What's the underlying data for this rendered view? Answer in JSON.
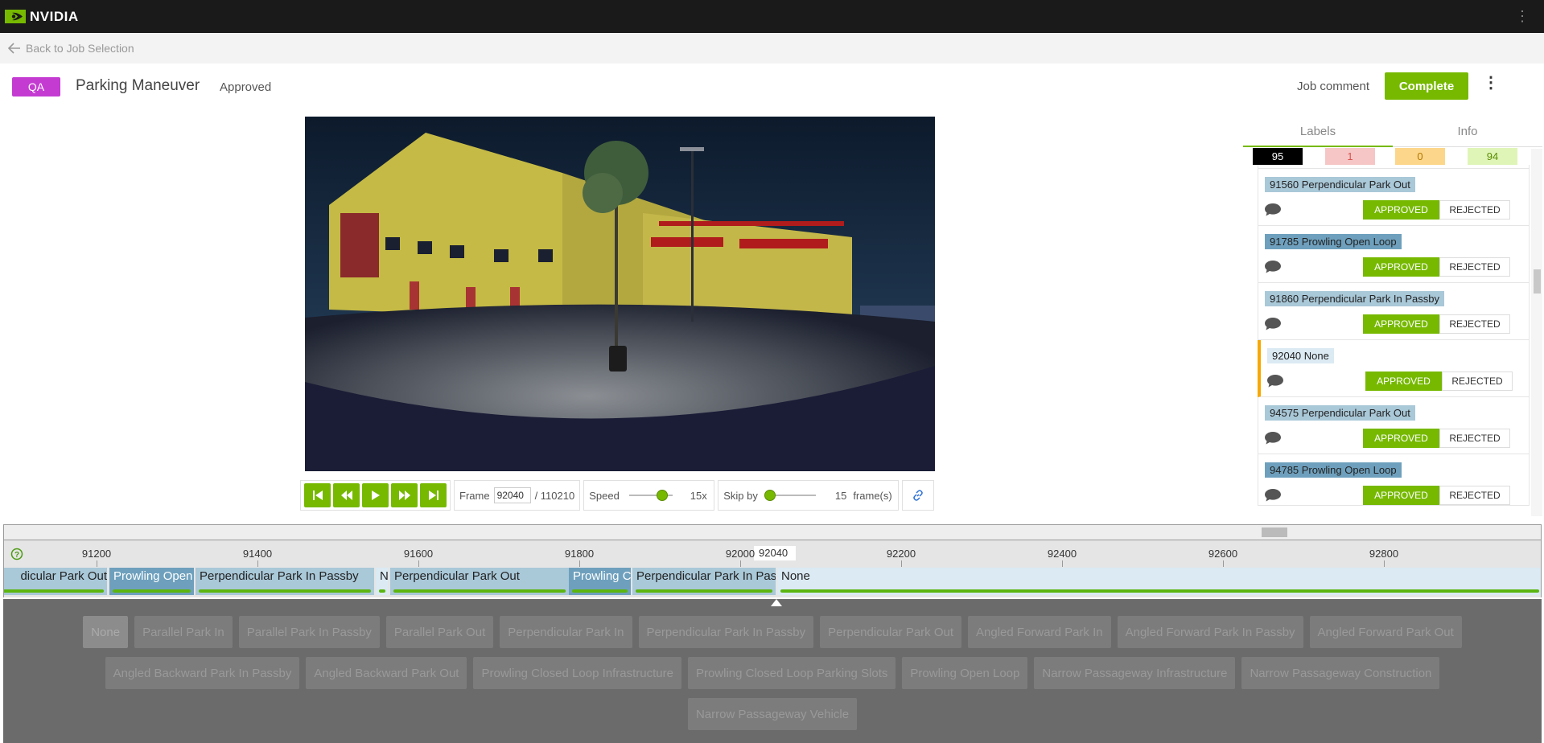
{
  "topbar": {
    "brand": "NVIDIA",
    "menu_icon": "vertical-dots"
  },
  "back_link": "Back to Job Selection",
  "header": {
    "badge": "QA",
    "title": "Parking Maneuver",
    "status": "Approved",
    "job_comment": "Job comment",
    "complete_label": "Complete"
  },
  "player": {
    "frame_label": "Frame",
    "frame_value": "92040",
    "frame_total": "/ 110210",
    "speed_label": "Speed",
    "speed_value": "15x",
    "speed_level": 0.85,
    "skip_label": "Skip by",
    "skip_value": "15",
    "skip_unit": "frame(s)",
    "skip_level": 0.0
  },
  "panel": {
    "tabs": [
      "Labels",
      "Info"
    ],
    "counts": [
      {
        "value": "95",
        "bg": "#000000",
        "fg": "#ffffff"
      },
      {
        "value": "1",
        "bg": "#f6c6c6",
        "fg": "#d9534f"
      },
      {
        "value": "0",
        "bg": "#fcd68a",
        "fg": "#b07800"
      },
      {
        "value": "94",
        "bg": "#dff5b8",
        "fg": "#5a8c00"
      }
    ],
    "approved_label": "APPROVED",
    "rejected_label": "REJECTED",
    "items": [
      {
        "label": "",
        "color": "#ffffff",
        "selected": false,
        "partial": true
      },
      {
        "label": "91560 Perpendicular Park Out",
        "color": "#a9c8d8",
        "selected": false
      },
      {
        "label": "91785 Prowling Open Loop",
        "color": "#6ea0bd",
        "selected": false
      },
      {
        "label": "91860 Perpendicular Park In Passby",
        "color": "#a9c8d8",
        "selected": false
      },
      {
        "label": "92040 None",
        "color": "#dbeaf3",
        "selected": true
      },
      {
        "label": "94575 Perpendicular Park Out",
        "color": "#a9c8d8",
        "selected": false
      },
      {
        "label": "94785 Prowling Open Loop",
        "color": "#6ea0bd",
        "selected": false
      }
    ]
  },
  "timeline": {
    "ticks": [
      "91200",
      "91400",
      "91600",
      "91800",
      "92000",
      "92200",
      "92400",
      "92600",
      "92800"
    ],
    "current_frame": "92040",
    "segments": [
      {
        "label": "dicular Park Out",
        "color": "#a9c8d8",
        "text_color": "#222"
      },
      {
        "label": "Prowling Open",
        "color": "#6ea0bd",
        "text_color": "#ffffff"
      },
      {
        "label": "Perpendicular Park In Passby",
        "color": "#a9c8d8",
        "text_color": "#222"
      },
      {
        "label": "N",
        "color": "#dbeaf3",
        "text_color": "#222"
      },
      {
        "label": "Perpendicular Park Out",
        "color": "#a9c8d8",
        "text_color": "#222"
      },
      {
        "label": "Prowling C",
        "color": "#6ea0bd",
        "text_color": "#ffffff"
      },
      {
        "label": "Perpendicular Park In Pass",
        "color": "#a9c8d8",
        "text_color": "#222"
      },
      {
        "label": "None",
        "color": "#dbeaf3",
        "text_color": "#222"
      }
    ]
  },
  "categories": [
    [
      "None",
      "Parallel Park In",
      "Parallel Park In Passby",
      "Parallel Park Out",
      "Perpendicular Park In",
      "Perpendicular Park In Passby",
      "Perpendicular Park Out",
      "Angled Forward Park In",
      "Angled Forward Park In Passby",
      "Angled Forward Park Out"
    ],
    [
      "Angled Backward Park In Passby",
      "Angled Backward Park Out",
      "Prowling Closed Loop Infrastructure",
      "Prowling Closed Loop Parking Slots",
      "Prowling Open Loop",
      "Narrow Passageway Infrastructure",
      "Narrow Passageway Construction"
    ],
    [
      "Narrow Passageway Vehicle"
    ]
  ]
}
